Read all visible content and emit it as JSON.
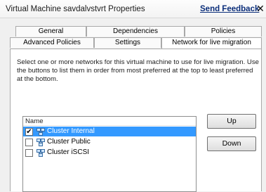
{
  "window": {
    "title": "Virtual Machine savdalvstvrt Properties",
    "feedback_link": "Send Feedback",
    "close_glyph": "✕"
  },
  "tabs": [
    {
      "label": "General",
      "active": false
    },
    {
      "label": "Dependencies",
      "active": false
    },
    {
      "label": "Policies",
      "active": false
    },
    {
      "label": "Advanced Policies",
      "active": false
    },
    {
      "label": "Settings",
      "active": false
    },
    {
      "label": "Network for live migration",
      "active": true
    }
  ],
  "panel": {
    "description": "Select one or more networks for this virtual machine to use for live migration. Use the buttons to list them in order from most preferred at the top to least preferred at the bottom.",
    "list_header": "Name",
    "networks": [
      {
        "name": "Cluster Internal",
        "checked": true,
        "selected": true,
        "check_glyph": "✔",
        "icon": "network-icon"
      },
      {
        "name": "Cluster Public",
        "checked": false,
        "selected": false,
        "check_glyph": "",
        "icon": "network-icon"
      },
      {
        "name": "Cluster iSCSI",
        "checked": false,
        "selected": false,
        "check_glyph": "",
        "icon": "network-icon"
      }
    ],
    "buttons": {
      "up": "Up",
      "down": "Down"
    }
  },
  "colors": {
    "selection": "#3399ff",
    "link": "#0b2e7a"
  }
}
